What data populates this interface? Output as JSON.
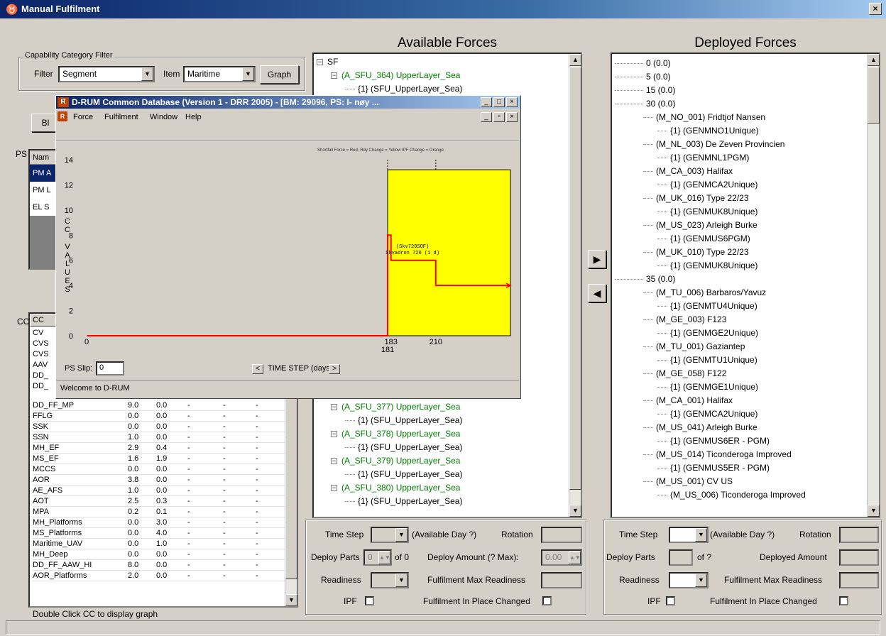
{
  "window": {
    "title": "Manual Fulfilment",
    "close_label": "×"
  },
  "filter_group": {
    "legend": "Capability Category Filter",
    "filter_label": "Filter",
    "filter_value": "Segment",
    "item_label": "Item",
    "item_value": "Maritime",
    "graph_button": "Graph"
  },
  "ps": {
    "label": "PS",
    "col_header": "Nam",
    "rows": [
      "PM A",
      "PM L",
      "EL S"
    ],
    "left_button": "Bl"
  },
  "cc": {
    "label": "CC",
    "col_header": "CC",
    "visible_prefix_rows": [
      "CV",
      "CVS",
      "CVS",
      "AAV",
      "DD_",
      "DD_"
    ],
    "rows": [
      {
        "name": "DD_FF_MP",
        "v1": "9.0",
        "v2": "0.0",
        "c3": "-",
        "c4": "-",
        "c5": "-"
      },
      {
        "name": "FFLG",
        "v1": "0.0",
        "v2": "0.0",
        "c3": "-",
        "c4": "-",
        "c5": "-"
      },
      {
        "name": "SSK",
        "v1": "0.0",
        "v2": "0.0",
        "c3": "-",
        "c4": "-",
        "c5": "-"
      },
      {
        "name": "SSN",
        "v1": "1.0",
        "v2": "0.0",
        "c3": "-",
        "c4": "-",
        "c5": "-"
      },
      {
        "name": "MH_EF",
        "v1": "2.9",
        "v2": "0.4",
        "c3": "-",
        "c4": "-",
        "c5": "-"
      },
      {
        "name": "MS_EF",
        "v1": "1.6",
        "v2": "1.9",
        "c3": "-",
        "c4": "-",
        "c5": "-"
      },
      {
        "name": "MCCS",
        "v1": "0.0",
        "v2": "0.0",
        "c3": "-",
        "c4": "-",
        "c5": "-"
      },
      {
        "name": "AOR",
        "v1": "3.8",
        "v2": "0.0",
        "c3": "-",
        "c4": "-",
        "c5": "-"
      },
      {
        "name": "AE_AFS",
        "v1": "1.0",
        "v2": "0.0",
        "c3": "-",
        "c4": "-",
        "c5": "-"
      },
      {
        "name": "AOT",
        "v1": "2.5",
        "v2": "0.3",
        "c3": "-",
        "c4": "-",
        "c5": "-"
      },
      {
        "name": "MPA",
        "v1": "0.2",
        "v2": "0.1",
        "c3": "-",
        "c4": "-",
        "c5": "-"
      },
      {
        "name": "MH_Platforms",
        "v1": "0.0",
        "v2": "3.0",
        "c3": "-",
        "c4": "-",
        "c5": "-"
      },
      {
        "name": "MS_Platforms",
        "v1": "0.0",
        "v2": "4.0",
        "c3": "-",
        "c4": "-",
        "c5": "-"
      },
      {
        "name": "Maritime_UAV",
        "v1": "0.0",
        "v2": "1.0",
        "c3": "-",
        "c4": "-",
        "c5": "-"
      },
      {
        "name": "MH_Deep",
        "v1": "0.0",
        "v2": "0.0",
        "c3": "-",
        "c4": "-",
        "c5": "-"
      },
      {
        "name": "DD_FF_AAW_HI",
        "v1": "8.0",
        "v2": "0.0",
        "c3": "-",
        "c4": "-",
        "c5": "-"
      },
      {
        "name": "AOR_Platforms",
        "v1": "2.0",
        "v2": "0.0",
        "c3": "-",
        "c4": "-",
        "c5": "-"
      }
    ],
    "hint": "Double Click CC to display graph"
  },
  "available": {
    "heading": "Available Forces",
    "tree_top": [
      {
        "text": "SF",
        "indent": 0,
        "green": false,
        "expander": "−"
      },
      {
        "text": "(A_SFU_364) UpperLayer_Sea",
        "indent": 1,
        "green": true,
        "expander": "−"
      },
      {
        "text": "{1} (SFU_UpperLayer_Sea)",
        "indent": 2,
        "green": false,
        "expander": ""
      }
    ],
    "tree_bottom": [
      {
        "text": "(A_SFU_377) UpperLayer_Sea",
        "indent": 1,
        "green": true,
        "expander": "−"
      },
      {
        "text": "{1} (SFU_UpperLayer_Sea)",
        "indent": 2,
        "green": false,
        "expander": ""
      },
      {
        "text": "(A_SFU_378) UpperLayer_Sea",
        "indent": 1,
        "green": true,
        "expander": "−"
      },
      {
        "text": "{1} (SFU_UpperLayer_Sea)",
        "indent": 2,
        "green": false,
        "expander": ""
      },
      {
        "text": "(A_SFU_379) UpperLayer_Sea",
        "indent": 1,
        "green": true,
        "expander": "−"
      },
      {
        "text": "{1} (SFU_UpperLayer_Sea)",
        "indent": 2,
        "green": false,
        "expander": ""
      },
      {
        "text": "(A_SFU_380) UpperLayer_Sea",
        "indent": 1,
        "green": true,
        "expander": "−"
      },
      {
        "text": "{1} (SFU_UpperLayer_Sea)",
        "indent": 2,
        "green": false,
        "expander": ""
      }
    ],
    "form": {
      "time_step": "Time Step",
      "available_day": "(Available Day ?)",
      "rotation": "Rotation",
      "deploy_parts": "Deploy Parts",
      "deploy_parts_value": "0",
      "of_label": "of 0",
      "deploy_amount": "Deploy Amount (? Max):",
      "deploy_amount_value": "0.00",
      "readiness": "Readiness",
      "fulfilment_max_readiness": "Fulfilment Max Readiness",
      "ipf": "IPF",
      "fulfilment_in_place_changed": "Fulfilment In Place Changed"
    }
  },
  "deployed": {
    "heading": "Deployed Forces",
    "tree": [
      {
        "text": "0 (0.0)",
        "indent": 0
      },
      {
        "text": "5 (0.0)",
        "indent": 0
      },
      {
        "text": "15 (0.0)",
        "indent": 0
      },
      {
        "text": "30 (0.0)",
        "indent": 0
      },
      {
        "text": "(M_NO_001) Fridtjof Nansen",
        "indent": 1
      },
      {
        "text": "{1} (GENMNO1Unique)",
        "indent": 2
      },
      {
        "text": "(M_NL_003) De Zeven Provincien",
        "indent": 1
      },
      {
        "text": "{1} (GENMNL1PGM)",
        "indent": 2
      },
      {
        "text": "(M_CA_003) Halifax",
        "indent": 1
      },
      {
        "text": "{1} (GENMCA2Unique)",
        "indent": 2
      },
      {
        "text": "(M_UK_016) Type 22/23",
        "indent": 1
      },
      {
        "text": "{1} (GENMUK8Unique)",
        "indent": 2
      },
      {
        "text": "(M_US_023) Arleigh Burke",
        "indent": 1
      },
      {
        "text": "{1} (GENMUS6PGM)",
        "indent": 2
      },
      {
        "text": "(M_UK_010) Type 22/23",
        "indent": 1
      },
      {
        "text": "{1} (GENMUK8Unique)",
        "indent": 2
      },
      {
        "text": "35 (0.0)",
        "indent": 0
      },
      {
        "text": "(M_TU_006) Barbaros/Yavuz",
        "indent": 1
      },
      {
        "text": "{1} (GENMTU4Unique)",
        "indent": 2
      },
      {
        "text": "(M_GE_003) F123",
        "indent": 1
      },
      {
        "text": "{1} (GENMGE2Unique)",
        "indent": 2
      },
      {
        "text": "(M_TU_001) Gaziantep",
        "indent": 1
      },
      {
        "text": "{1} (GENMTU1Unique)",
        "indent": 2
      },
      {
        "text": "(M_GE_058) F122",
        "indent": 1
      },
      {
        "text": "{1} (GENMGE1Unique)",
        "indent": 2
      },
      {
        "text": "(M_CA_001) Halifax",
        "indent": 1
      },
      {
        "text": "{1} (GENMCA2Unique)",
        "indent": 2
      },
      {
        "text": "(M_US_041) Arleigh Burke",
        "indent": 1
      },
      {
        "text": "{1} (GENMUS6ER - PGM)",
        "indent": 2
      },
      {
        "text": "(M_US_014) Ticonderoga Improved",
        "indent": 1
      },
      {
        "text": "{1} (GENMUS5ER - PGM)",
        "indent": 2
      },
      {
        "text": "(M_US_001) CV US",
        "indent": 1
      },
      {
        "text": "(M_US_006) Ticonderoga Improved",
        "indent": 2
      }
    ],
    "form": {
      "time_step": "Time Step",
      "available_day": "(Available Day ?)",
      "rotation": "Rotation",
      "deploy_parts": "Deploy Parts",
      "of_label": "of ?",
      "deployed_amount": "Deployed Amount",
      "readiness": "Readiness",
      "fulfilment_max_readiness": "Fulfilment Max Readiness",
      "ipf": "IPF",
      "fulfilment_in_place_changed": "Fulfilment In Place Changed"
    }
  },
  "transfer": {
    "right_arrow": "▶",
    "left_arrow": "◀"
  },
  "overlay": {
    "title": "D-RUM Common Database (Version 1 - DRR 2005) - [BM: 29096, PS: I-                    nøy ...",
    "menu": [
      "Force",
      "Fulfilment",
      "Window",
      "Help"
    ],
    "legend_note": "Shortfall Force = Red, Rdy Change = Yellow IPF Change = Orange",
    "ylabel_letters": [
      "C",
      "C",
      " ",
      "V",
      "A",
      "L",
      "U",
      "E",
      "S"
    ],
    "ps_slip_label": "PS Slip:",
    "ps_slip_value": "0",
    "time_step_label": "TIME STEP (days)",
    "status": "Welcome to D-RUM",
    "annotation_1": "(Skv720SOF)",
    "annotation_2": "Skvadron 720 (1 d)"
  },
  "chart_data": {
    "type": "line",
    "ylabel": "CC VALUES",
    "xlabel": "TIME STEP (days)",
    "ylim": [
      0,
      14
    ],
    "yticks": [
      0,
      2,
      4,
      6,
      8,
      10,
      12,
      14
    ],
    "xticks": [
      0,
      181,
      183,
      210
    ],
    "x_range": [
      0,
      255
    ],
    "series": [
      {
        "points": [
          [
            0,
            0
          ],
          [
            181,
            0
          ],
          [
            181,
            8
          ],
          [
            183,
            8
          ],
          [
            183,
            6
          ],
          [
            210,
            6
          ],
          [
            210,
            4
          ],
          [
            255,
            4
          ]
        ]
      }
    ],
    "highlight_region": {
      "x0": 181,
      "x1": 255,
      "y0": 0,
      "y1": 13.2,
      "color": "#ffff00"
    },
    "markers": [
      181,
      210
    ],
    "line_color": "#ff0000"
  }
}
